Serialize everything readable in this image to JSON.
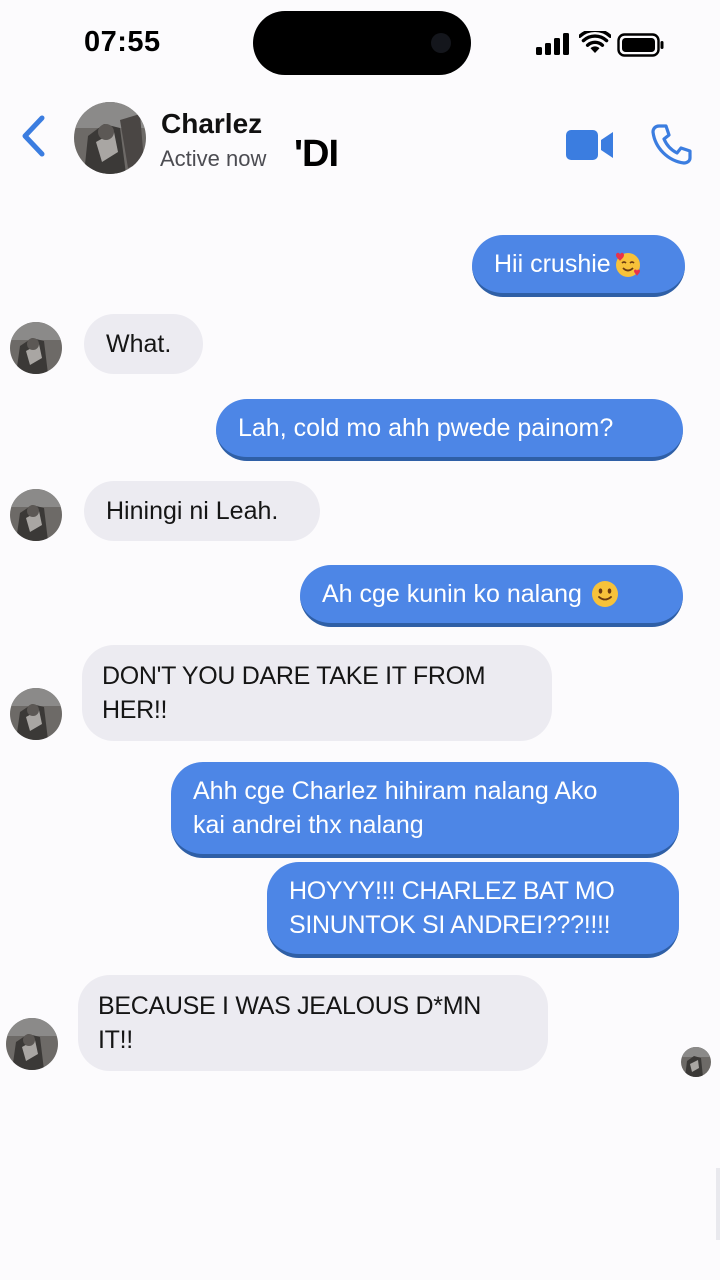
{
  "status_bar": {
    "time": "07:55"
  },
  "header": {
    "contact_name": "Charlez",
    "status": "Active now",
    "overlay_text": "'DI"
  },
  "colors": {
    "outgoing": "#4d86e6",
    "incoming": "#ecebf1",
    "accent": "#3b7de0"
  },
  "icons": [
    "back-chevron",
    "video-camera",
    "phone",
    "signal",
    "wifi",
    "battery"
  ],
  "messages": [
    {
      "from": "me",
      "text": "Hii crushie",
      "emoji": "smiling-face-with-hearts"
    },
    {
      "from": "contact",
      "text": "What."
    },
    {
      "from": "me",
      "text": "Lah, cold mo ahh pwede painom?"
    },
    {
      "from": "contact",
      "text": "Hiningi ni Leah."
    },
    {
      "from": "me",
      "text": "Ah cge kunin ko nalang",
      "emoji": "slightly-smiling-face"
    },
    {
      "from": "contact",
      "lines": [
        "DON'T YOU DARE TAKE IT FROM",
        "HER!!"
      ]
    },
    {
      "from": "me",
      "lines": [
        "Ahh cge Charlez hihiram nalang Ako",
        "kai andrei thx nalang"
      ]
    },
    {
      "from": "me",
      "lines": [
        "HOYYY!!! CHARLEZ BAT MO",
        "SINUNTOK SI ANDREI???!!!!"
      ]
    },
    {
      "from": "contact",
      "lines": [
        "BECAUSE I WAS JEALOUS D*MN",
        "IT!!"
      ]
    }
  ]
}
